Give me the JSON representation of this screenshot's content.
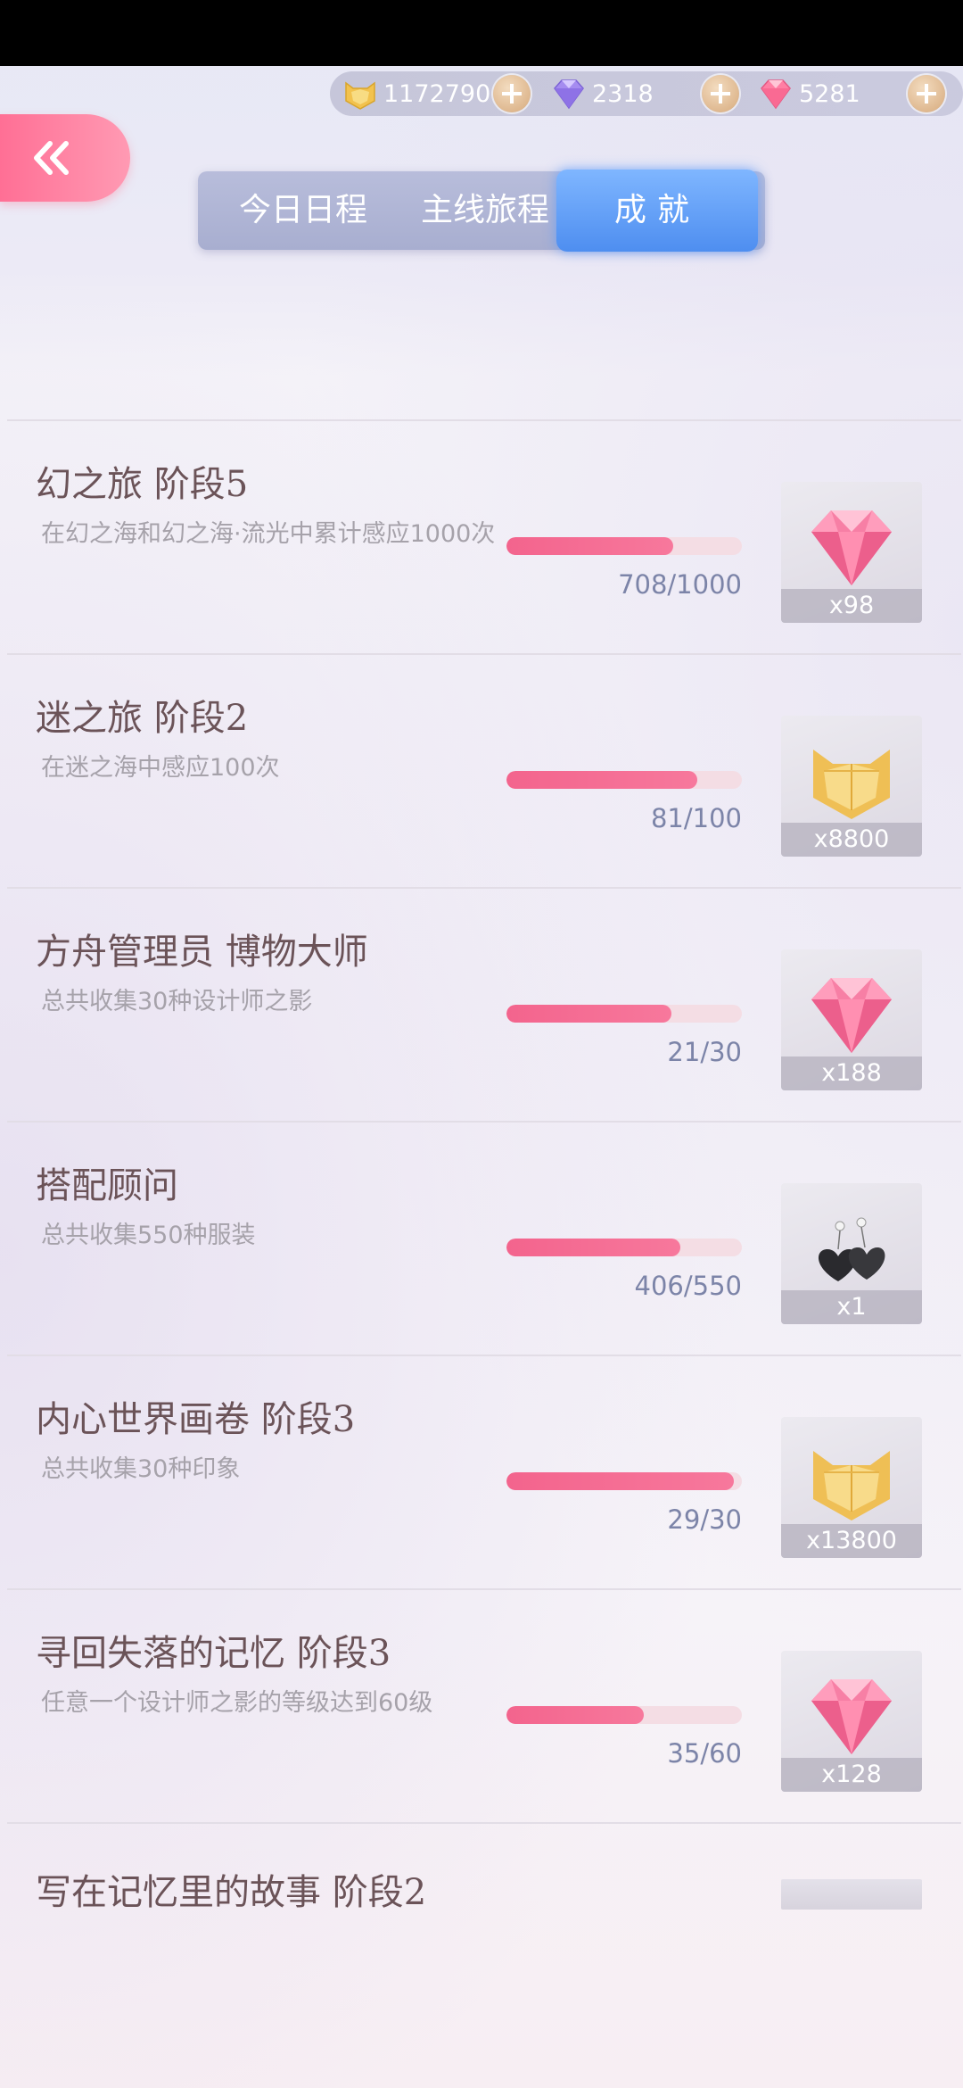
{
  "currency": {
    "gold": "1172790",
    "purple_diamond": "2318",
    "pink_diamond": "5281"
  },
  "tabs": {
    "daily": "今日日程",
    "main": "主线旅程",
    "achievements": "成就"
  },
  "achievements": [
    {
      "title": "幻之旅 阶段5",
      "desc": "在幻之海和幻之海·流光中累计感应1000次",
      "progress_text": "708/1000",
      "progress": 0.708,
      "reward_icon": "pink-diamond",
      "reward_count": "x98"
    },
    {
      "title": "迷之旅 阶段2",
      "desc": "在迷之海中感应100次",
      "progress_text": "81/100",
      "progress": 0.81,
      "reward_icon": "gold-cat-coin",
      "reward_count": "x8800"
    },
    {
      "title": "方舟管理员 博物大师",
      "desc": "总共收集30种设计师之影",
      "progress_text": "21/30",
      "progress": 0.7,
      "reward_icon": "pink-diamond",
      "reward_count": "x188"
    },
    {
      "title": "搭配顾问",
      "desc": "总共收集550种服装",
      "progress_text": "406/550",
      "progress": 0.738,
      "reward_icon": "black-heart-earrings",
      "reward_count": "x1"
    },
    {
      "title": "内心世界画卷 阶段3",
      "desc": "总共收集30种印象",
      "progress_text": "29/30",
      "progress": 0.967,
      "reward_icon": "gold-cat-coin",
      "reward_count": "x13800"
    },
    {
      "title": "寻回失落的记忆 阶段3",
      "desc": "任意一个设计师之影的等级达到60级",
      "progress_text": "35/60",
      "progress": 0.583,
      "reward_icon": "pink-diamond",
      "reward_count": "x128"
    }
  ],
  "partial_item": {
    "title": "写在记忆里的故事 阶段2"
  },
  "colors": {
    "accent_pink": "#f3648d",
    "tab_active": "#4e8ef0",
    "title": "#6b5358"
  }
}
